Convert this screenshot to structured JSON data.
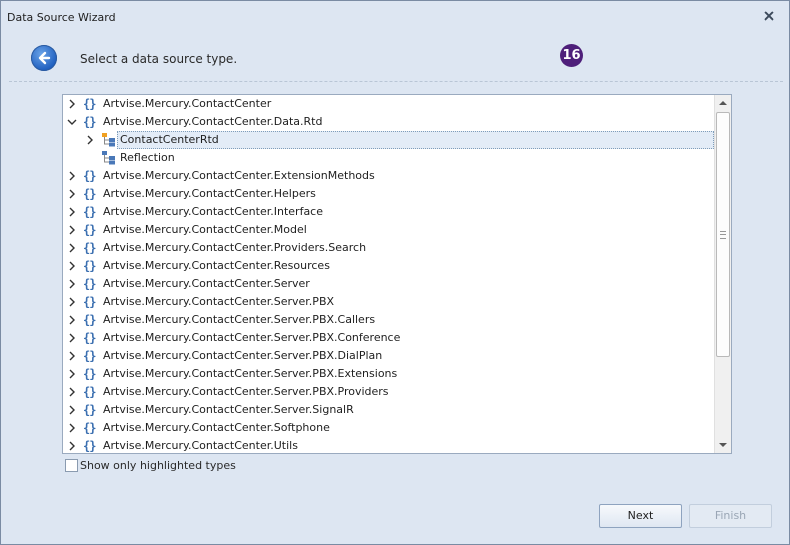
{
  "window": {
    "title": "Data Source Wizard"
  },
  "header": {
    "instruction": "Select a data source type.",
    "badge": "16"
  },
  "tree": {
    "items": [
      {
        "label": "Artvise.Mercury.ContactCenter",
        "kind": "namespace",
        "state": "collapsed",
        "level": 0
      },
      {
        "label": "Artvise.Mercury.ContactCenter.Data.Rtd",
        "kind": "namespace",
        "state": "expanded",
        "level": 0
      },
      {
        "label": "ContactCenterRtd",
        "kind": "type",
        "state": "collapsed",
        "level": 1,
        "selected": true
      },
      {
        "label": "Reflection",
        "kind": "type",
        "state": "leaf",
        "level": 1
      },
      {
        "label": "Artvise.Mercury.ContactCenter.ExtensionMethods",
        "kind": "namespace",
        "state": "collapsed",
        "level": 0
      },
      {
        "label": "Artvise.Mercury.ContactCenter.Helpers",
        "kind": "namespace",
        "state": "collapsed",
        "level": 0
      },
      {
        "label": "Artvise.Mercury.ContactCenter.Interface",
        "kind": "namespace",
        "state": "collapsed",
        "level": 0
      },
      {
        "label": "Artvise.Mercury.ContactCenter.Model",
        "kind": "namespace",
        "state": "collapsed",
        "level": 0
      },
      {
        "label": "Artvise.Mercury.ContactCenter.Providers.Search",
        "kind": "namespace",
        "state": "collapsed",
        "level": 0
      },
      {
        "label": "Artvise.Mercury.ContactCenter.Resources",
        "kind": "namespace",
        "state": "collapsed",
        "level": 0
      },
      {
        "label": "Artvise.Mercury.ContactCenter.Server",
        "kind": "namespace",
        "state": "collapsed",
        "level": 0
      },
      {
        "label": "Artvise.Mercury.ContactCenter.Server.PBX",
        "kind": "namespace",
        "state": "collapsed",
        "level": 0
      },
      {
        "label": "Artvise.Mercury.ContactCenter.Server.PBX.Callers",
        "kind": "namespace",
        "state": "collapsed",
        "level": 0
      },
      {
        "label": "Artvise.Mercury.ContactCenter.Server.PBX.Conference",
        "kind": "namespace",
        "state": "collapsed",
        "level": 0
      },
      {
        "label": "Artvise.Mercury.ContactCenter.Server.PBX.DialPlan",
        "kind": "namespace",
        "state": "collapsed",
        "level": 0
      },
      {
        "label": "Artvise.Mercury.ContactCenter.Server.PBX.Extensions",
        "kind": "namespace",
        "state": "collapsed",
        "level": 0
      },
      {
        "label": "Artvise.Mercury.ContactCenter.Server.PBX.Providers",
        "kind": "namespace",
        "state": "collapsed",
        "level": 0
      },
      {
        "label": "Artvise.Mercury.ContactCenter.Server.SignalR",
        "kind": "namespace",
        "state": "collapsed",
        "level": 0
      },
      {
        "label": "Artvise.Mercury.ContactCenter.Softphone",
        "kind": "namespace",
        "state": "collapsed",
        "level": 0
      },
      {
        "label": "Artvise.Mercury.ContactCenter.Utils",
        "kind": "namespace",
        "state": "collapsed",
        "level": 0
      }
    ]
  },
  "options": {
    "show_highlighted_label": "Show only highlighted types",
    "show_highlighted_checked": false
  },
  "footer": {
    "next_label": "Next",
    "finish_label": "Finish"
  },
  "colors": {
    "window_bg": "#dde6f2",
    "badge_bg": "#4e1f7a",
    "namespace_icon": "#3b6fb0",
    "type_icon_orange": "#f0a020",
    "type_icon_blue": "#4a78b8"
  }
}
